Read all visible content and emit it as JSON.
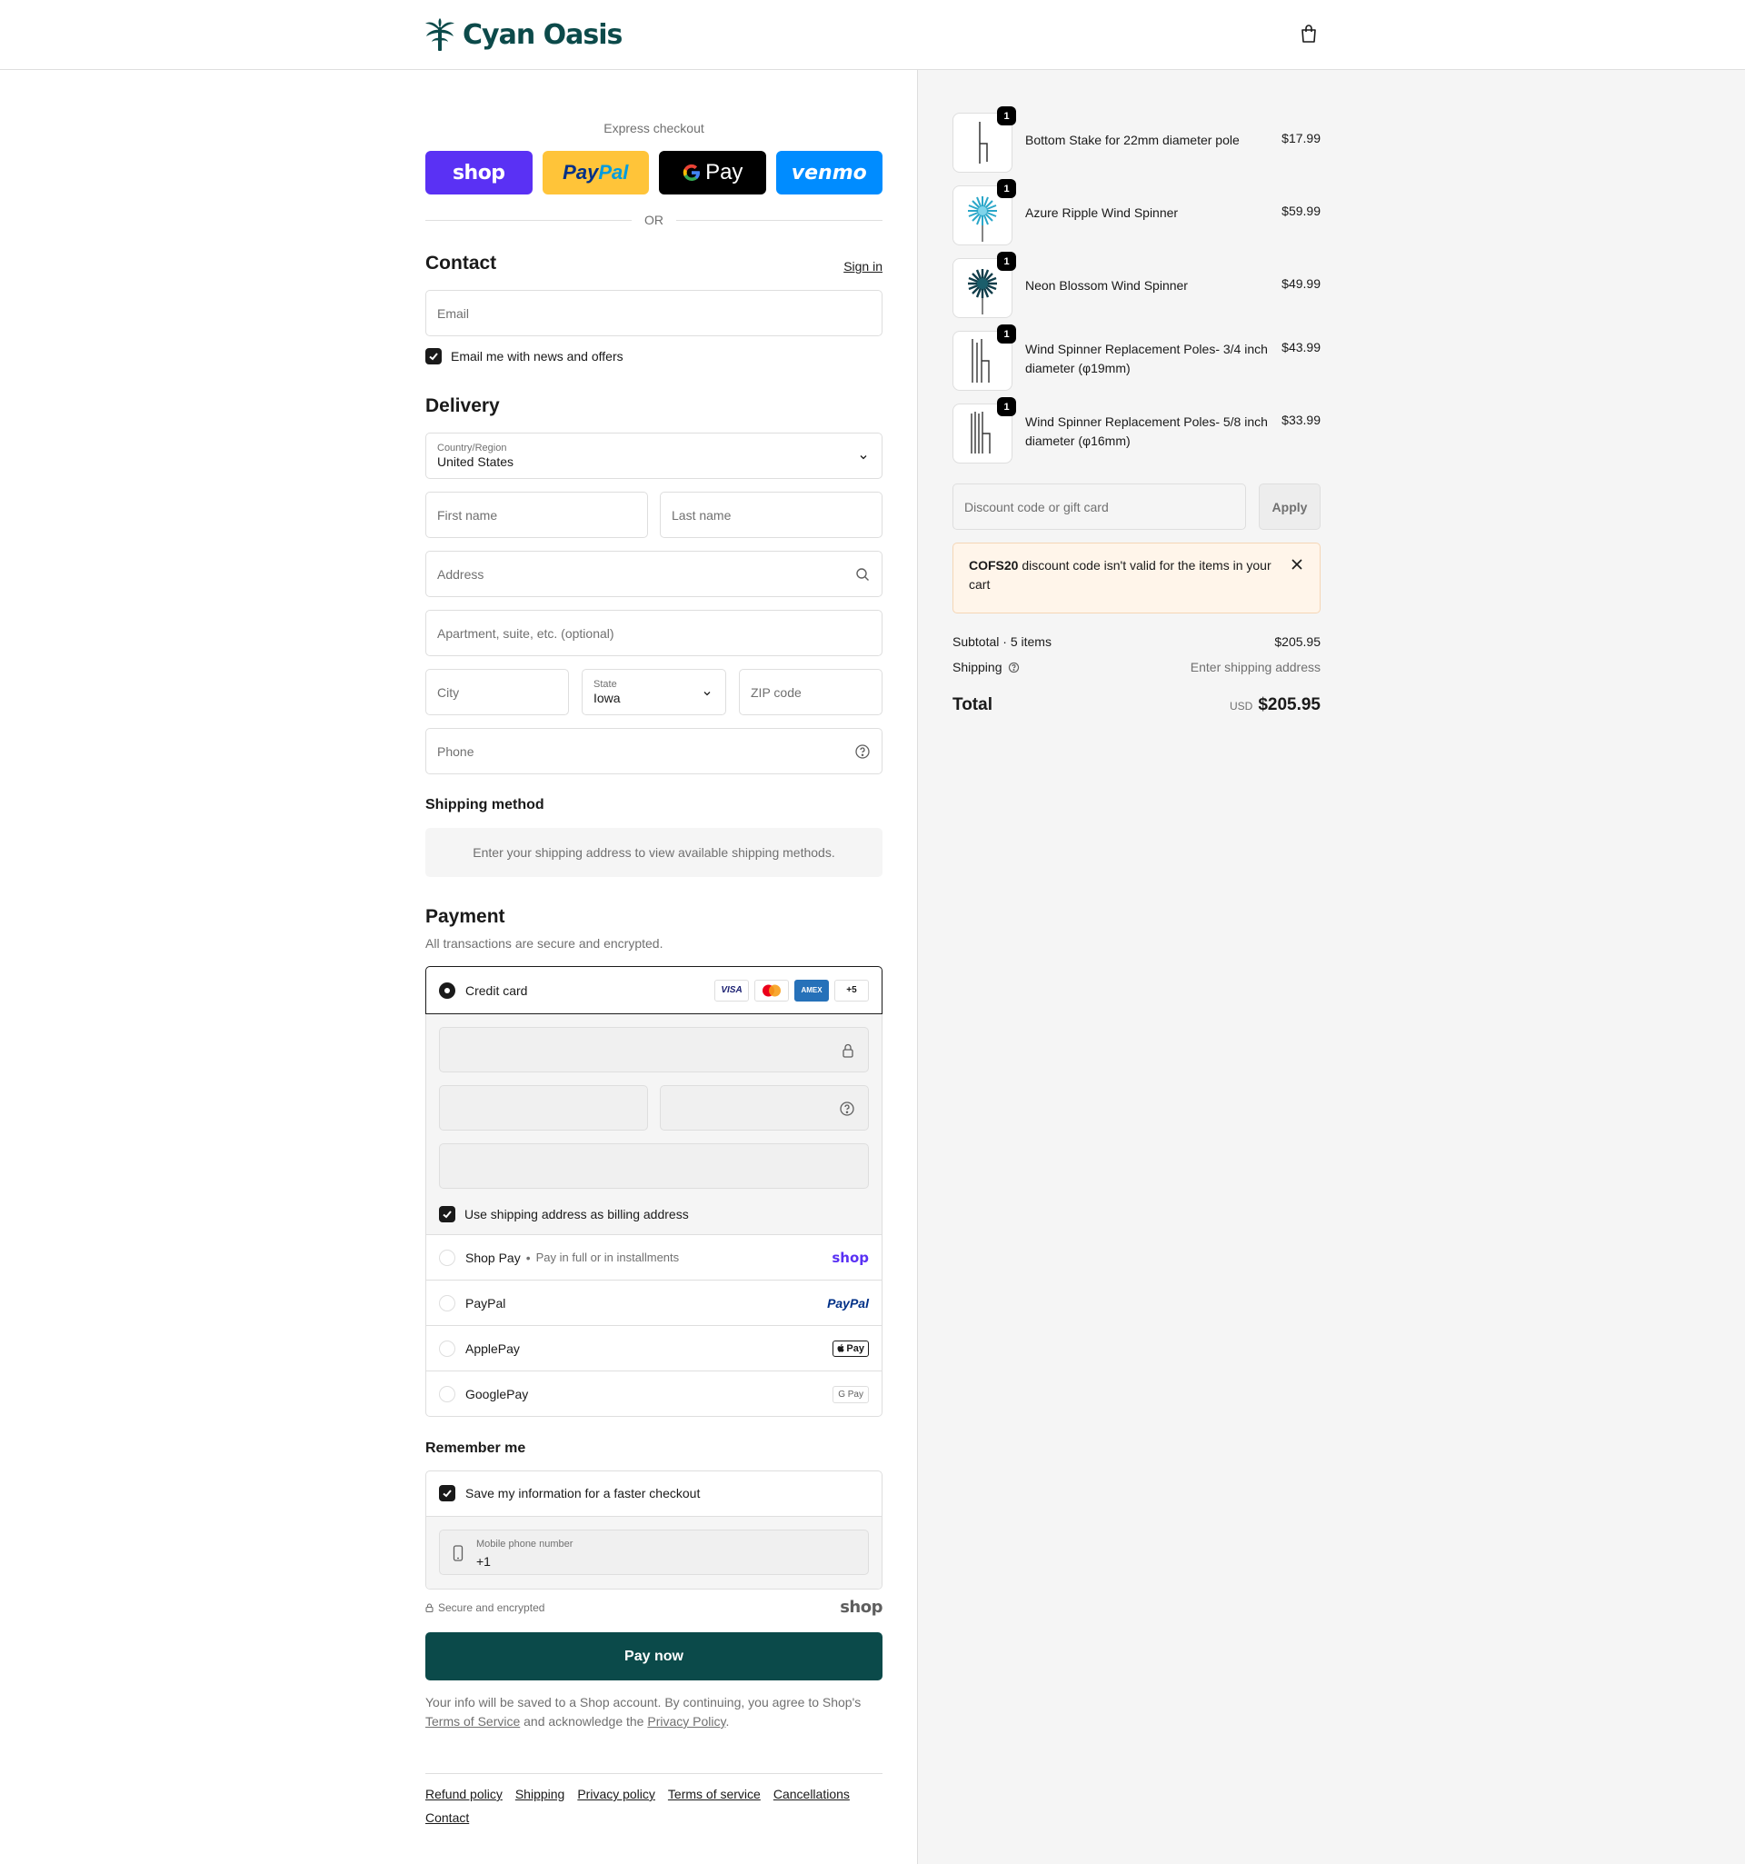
{
  "brand": {
    "name": "Cyan Oasis",
    "color": "#0c4a4a"
  },
  "header": {
    "cart_icon": "shopping-bag-icon"
  },
  "express": {
    "title": "Express checkout",
    "buttons": [
      {
        "name": "shop",
        "label": "shop",
        "color": "#5a31f4"
      },
      {
        "name": "paypal",
        "label_1": "Pay",
        "label_2": "Pal",
        "color": "#ffc439"
      },
      {
        "name": "gpay",
        "label": "Pay",
        "color": "#000000"
      },
      {
        "name": "venmo",
        "label": "venmo",
        "color": "#008cff"
      }
    ],
    "or": "OR"
  },
  "contact": {
    "title": "Contact",
    "sign_in": "Sign in",
    "email_placeholder": "Email",
    "newsletter": "Email me with news and offers"
  },
  "delivery": {
    "title": "Delivery",
    "country_label": "Country/Region",
    "country_value": "United States",
    "first_name": "First name",
    "last_name": "Last name",
    "address": "Address",
    "apartment": "Apartment, suite, etc. (optional)",
    "city": "City",
    "state_label": "State",
    "state_value": "Iowa",
    "zip": "ZIP code",
    "phone": "Phone"
  },
  "shipping_method": {
    "title": "Shipping method",
    "info": "Enter your shipping address to view available shipping methods."
  },
  "payment": {
    "title": "Payment",
    "subtitle": "All transactions are secure and encrypted.",
    "credit_card": "Credit card",
    "card_badges": [
      "VISA",
      "MC",
      "AMEX",
      "+5"
    ],
    "billing_same": "Use shipping address as billing address",
    "options": [
      {
        "label": "Shop Pay",
        "sub": "Pay in full or in installments",
        "brand": "shop"
      },
      {
        "label": "PayPal",
        "brand": "PayPal"
      },
      {
        "label": "ApplePay",
        "brand": "Pay"
      },
      {
        "label": "GooglePay",
        "brand": "G Pay"
      }
    ]
  },
  "remember": {
    "title": "Remember me",
    "save_info": "Save my information for a faster checkout",
    "mobile_label": "Mobile phone number",
    "mobile_value": "+1"
  },
  "secure": {
    "text": "Secure and encrypted",
    "shop_mark": "shop"
  },
  "pay_now": "Pay now",
  "legal": {
    "prefix": "Your info will be saved to a Shop account. By continuing, you agree to Shop's",
    "terms": "Terms of Service",
    "middle": "and acknowledge the",
    "privacy": "Privacy Policy",
    "suffix": "."
  },
  "footer": {
    "links": [
      "Refund policy",
      "Shipping",
      "Privacy policy",
      "Terms of service",
      "Cancellations",
      "Contact"
    ]
  },
  "cart": {
    "items": [
      {
        "name": "Bottom Stake for 22mm diameter pole",
        "price": "$17.99",
        "qty": "1"
      },
      {
        "name": "Azure Ripple Wind Spinner",
        "price": "$59.99",
        "qty": "1"
      },
      {
        "name": "Neon Blossom Wind Spinner",
        "price": "$49.99",
        "qty": "1"
      },
      {
        "name": "Wind Spinner Replacement Poles- 3/4 inch diameter (φ19mm)",
        "price": "$43.99",
        "qty": "1"
      },
      {
        "name": "Wind Spinner Replacement Poles- 5/8 inch diameter (φ16mm)",
        "price": "$33.99",
        "qty": "1"
      }
    ],
    "discount_placeholder": "Discount code or gift card",
    "apply": "Apply",
    "alert_code": "COFS20",
    "alert_text": "discount code isn't valid for the items in your cart",
    "subtotal_label": "Subtotal · 5 items",
    "subtotal_value": "$205.95",
    "shipping_label": "Shipping",
    "shipping_value": "Enter shipping address",
    "total_label": "Total",
    "total_currency": "USD",
    "total_value": "$205.95"
  }
}
